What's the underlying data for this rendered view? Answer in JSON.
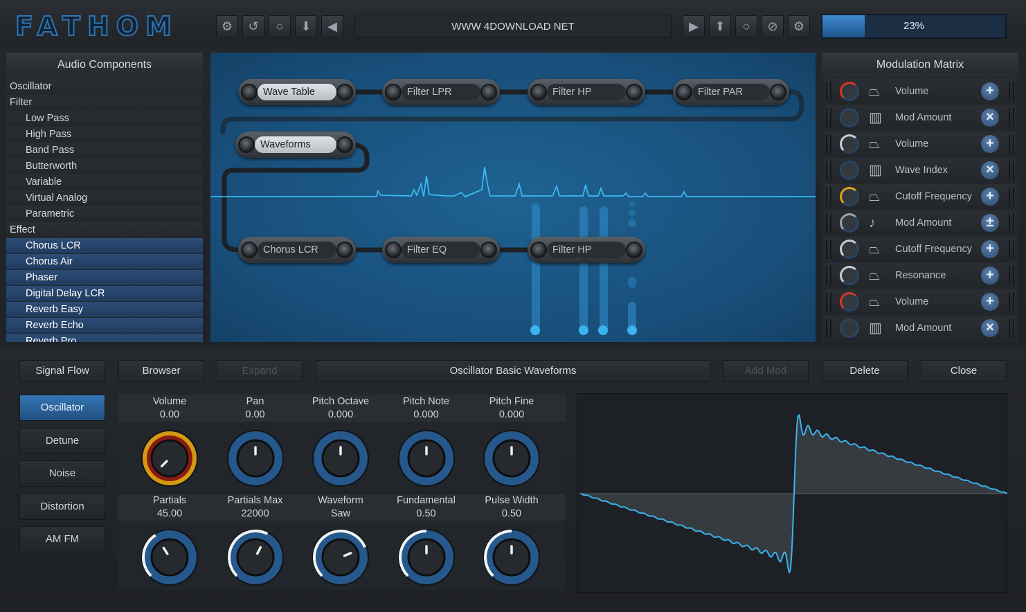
{
  "header": {
    "logo": "FATHOM",
    "url": "WWW 4DOWNLOAD NET",
    "progress_pct": 23,
    "progress_label": "23%"
  },
  "toolbar_left": [
    {
      "name": "settings-gear-icon",
      "glyph": "⚙"
    },
    {
      "name": "undo-icon",
      "glyph": "↺"
    },
    {
      "name": "record-circle-icon",
      "glyph": "○"
    },
    {
      "name": "download-arrow-icon",
      "glyph": "⬇"
    },
    {
      "name": "play-back-icon",
      "glyph": "◀"
    }
  ],
  "toolbar_right": [
    {
      "name": "play-forward-icon",
      "glyph": "▶"
    },
    {
      "name": "upload-arrow-icon",
      "glyph": "⬆"
    },
    {
      "name": "circle-icon",
      "glyph": "○"
    },
    {
      "name": "disable-icon",
      "glyph": "⊘"
    },
    {
      "name": "settings-gear-right-icon",
      "glyph": "⚙"
    }
  ],
  "audio_components": {
    "title": "Audio Components",
    "items": [
      {
        "label": "Oscillator",
        "type": "cat"
      },
      {
        "label": "Filter",
        "type": "cat"
      },
      {
        "label": "Low Pass",
        "type": "sub"
      },
      {
        "label": "High Pass",
        "type": "sub"
      },
      {
        "label": "Band Pass",
        "type": "sub"
      },
      {
        "label": "Butterworth",
        "type": "sub"
      },
      {
        "label": "Variable",
        "type": "sub"
      },
      {
        "label": "Virtual Analog",
        "type": "sub"
      },
      {
        "label": "Parametric",
        "type": "sub"
      },
      {
        "label": "Effect",
        "type": "cat"
      },
      {
        "label": "Chorus LCR",
        "type": "sub sel"
      },
      {
        "label": "Chorus Air",
        "type": "sub sel"
      },
      {
        "label": "Phaser",
        "type": "sub sel"
      },
      {
        "label": "Digital Delay LCR",
        "type": "sub sel"
      },
      {
        "label": "Reverb Easy",
        "type": "sub sel"
      },
      {
        "label": "Reverb Echo",
        "type": "sub sel"
      },
      {
        "label": "Reverb Pro",
        "type": "sub sel"
      }
    ]
  },
  "canvas": {
    "nodes": [
      {
        "label": "Wave Table",
        "active": true
      },
      {
        "label": "Filter LPR",
        "active": false
      },
      {
        "label": "Filter HP",
        "active": false
      },
      {
        "label": "Filter PAR",
        "active": false
      },
      {
        "label": "Waveforms",
        "active": true
      },
      {
        "label": "Chorus LCR",
        "active": false
      },
      {
        "label": "Filter EQ",
        "active": false
      },
      {
        "label": "Filter HP",
        "active": false
      }
    ]
  },
  "mod_matrix": {
    "title": "Modulation Matrix",
    "rows": [
      {
        "label": "Volume",
        "icon": "envelope-icon",
        "btn": "+",
        "knob": "#d8352a"
      },
      {
        "label": "Mod Amount",
        "icon": "keyboard-icon",
        "btn": "×",
        "knob": ""
      },
      {
        "label": "Volume",
        "icon": "envelope-icon",
        "btn": "+",
        "knob": "#c9ced3"
      },
      {
        "label": "Wave Index",
        "icon": "keyboard-icon",
        "btn": "×",
        "knob": ""
      },
      {
        "label": "Cutoff Frequency",
        "icon": "envelope-icon",
        "btn": "+",
        "knob": "#e0a21a"
      },
      {
        "label": "Mod Amount",
        "icon": "music-note-icon",
        "btn": "±",
        "knob": "#9aa3ab"
      },
      {
        "label": "Cutoff Frequency",
        "icon": "envelope-icon",
        "btn": "+",
        "knob": "#c9ced3"
      },
      {
        "label": "Resonance",
        "icon": "envelope-icon",
        "btn": "+",
        "knob": "#c9ced3"
      },
      {
        "label": "Volume",
        "icon": "envelope-icon",
        "btn": "+",
        "knob": "#d8352a"
      },
      {
        "label": "Mod Amount",
        "icon": "keyboard-icon",
        "btn": "×",
        "knob": ""
      }
    ]
  },
  "bottom_bar": {
    "signal_flow": "Signal Flow",
    "browser": "Browser",
    "expand": "Expand",
    "module_name": "Oscillator Basic Waveforms",
    "add_mod": "Add Mod",
    "delete": "Delete",
    "close": "Close"
  },
  "side_tabs": [
    "Oscillator",
    "Detune",
    "Noise",
    "Distortion",
    "AM FM"
  ],
  "params_row1": [
    {
      "name": "Volume",
      "value": "0.00",
      "level": 0.0,
      "style": "gold"
    },
    {
      "name": "Pan",
      "value": "0.00",
      "level": 0.5,
      "style": "blue"
    },
    {
      "name": "Pitch Octave",
      "value": "0.000",
      "level": 0.5,
      "style": "blue"
    },
    {
      "name": "Pitch Note",
      "value": "0.000",
      "level": 0.5,
      "style": "blue"
    },
    {
      "name": "Pitch Fine",
      "value": "0.000",
      "level": 0.5,
      "style": "blue"
    }
  ],
  "params_row2": [
    {
      "name": "Partials",
      "value": "45.00",
      "level": 0.38,
      "style": "white"
    },
    {
      "name": "Partials Max",
      "value": "22000",
      "level": 0.6,
      "style": "white"
    },
    {
      "name": "Waveform",
      "value": "Saw",
      "level": 0.75,
      "style": "white"
    },
    {
      "name": "Fundamental",
      "value": "0.50",
      "level": 0.5,
      "style": "white"
    },
    {
      "name": "Pulse Width",
      "value": "0.50",
      "level": 0.5,
      "style": "white"
    }
  ]
}
